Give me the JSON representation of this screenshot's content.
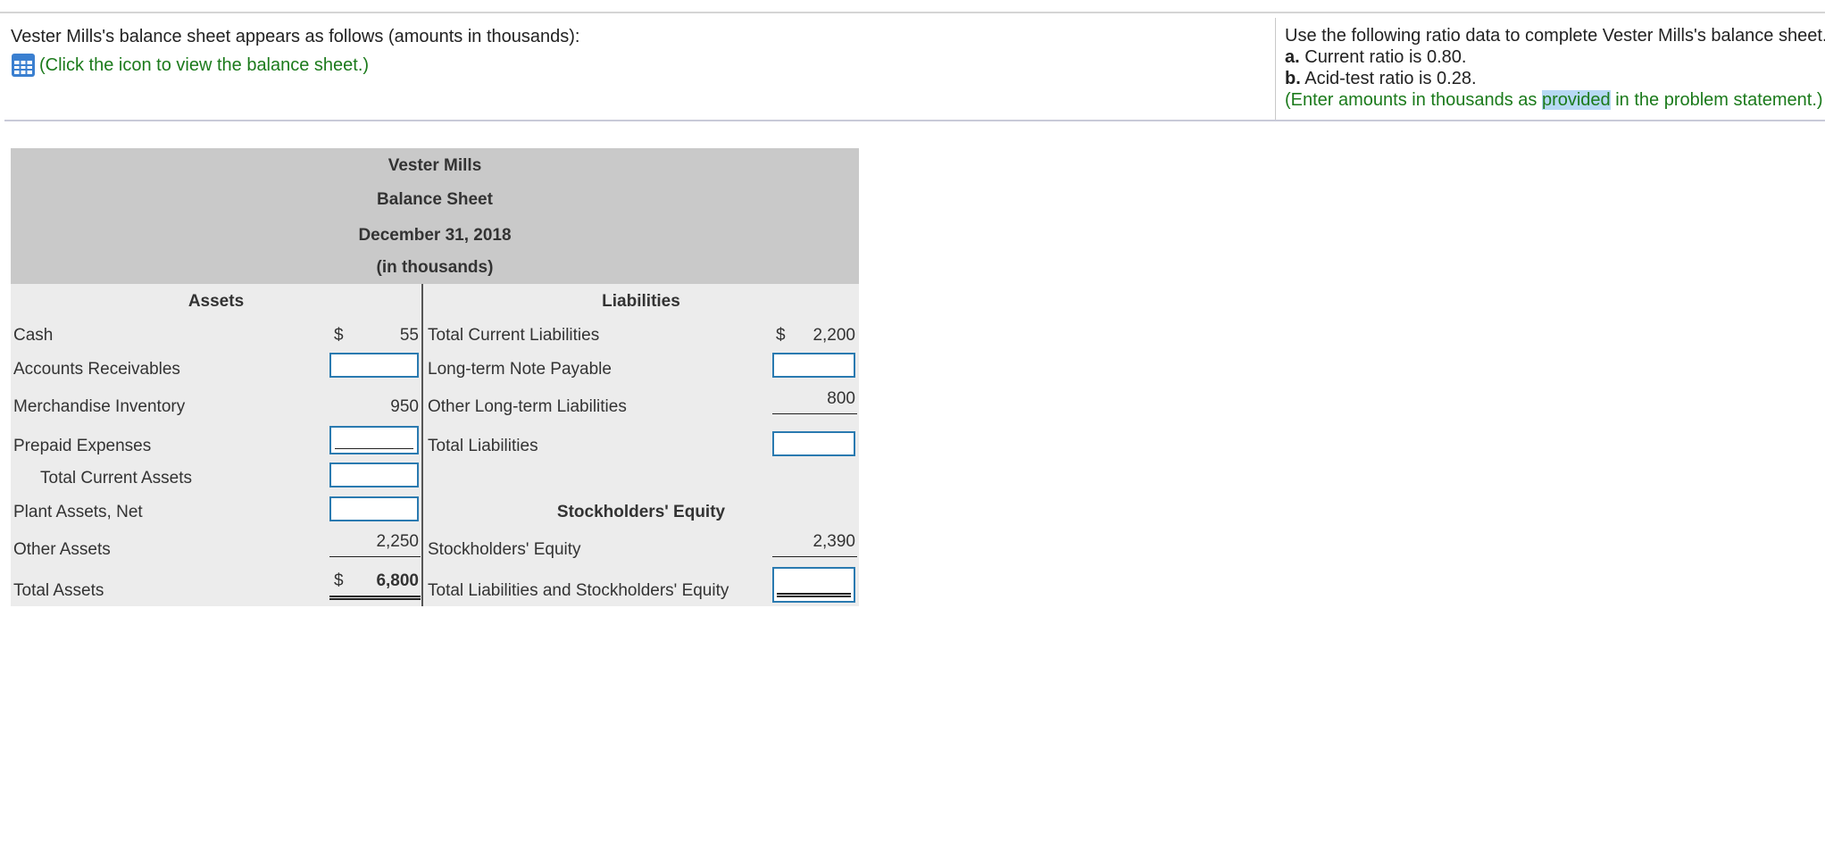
{
  "problem": {
    "intro": "Vester Mills's balance sheet appears as follows (amounts in thousands):",
    "icon_link": "(Click the icon to view the balance sheet.)",
    "instructions_line1": "Use the following ratio data to complete Vester Mills's balance sheet.",
    "item_a_label": "a.",
    "item_a_text": " Current ratio is 0.80.",
    "item_b_label": "b.",
    "item_b_text": " Acid-test ratio is 0.28.",
    "note_pre": "(Enter amounts in thousands as ",
    "note_highlight": "provided",
    "note_post": " in the problem statement.)"
  },
  "sheet": {
    "company": "Vester Mills",
    "title": "Balance Sheet",
    "date": "December 31, 2018",
    "units": "(in thousands)",
    "assets_header": "Assets",
    "liabilities_header": "Liabilities",
    "equity_header": "Stockholders' Equity",
    "currency": "$",
    "assets": {
      "cash_label": "Cash",
      "cash_value": "55",
      "ar_label": "Accounts Receivables",
      "ar_value": "",
      "inventory_label": "Merchandise Inventory",
      "inventory_value": "950",
      "prepaid_label": "Prepaid Expenses",
      "prepaid_value": "",
      "tca_label": "Total Current Assets",
      "tca_value": "",
      "plant_label": "Plant Assets, Net",
      "plant_value": "",
      "other_label": "Other Assets",
      "other_value": "2,250",
      "total_label": "Total Assets",
      "total_value": "6,800"
    },
    "liabilities": {
      "tcl_label": "Total Current Liabilities",
      "tcl_value": "2,200",
      "ltnp_label": "Long-term Note Payable",
      "ltnp_value": "",
      "oltl_label": "Other Long-term Liabilities",
      "oltl_value": "800",
      "tl_label": "Total Liabilities",
      "tl_value": "",
      "se_label": "Stockholders' Equity",
      "se_value": "2,390",
      "tlse_label": "Total Liabilities and Stockholders' Equity",
      "tlse_value": ""
    }
  },
  "colors": {
    "link_green": "#1b7a1b",
    "input_border": "#2a7ab0",
    "header_gray": "#c9c9c9",
    "body_gray": "#ececec",
    "highlight": "#b7d9f4"
  }
}
